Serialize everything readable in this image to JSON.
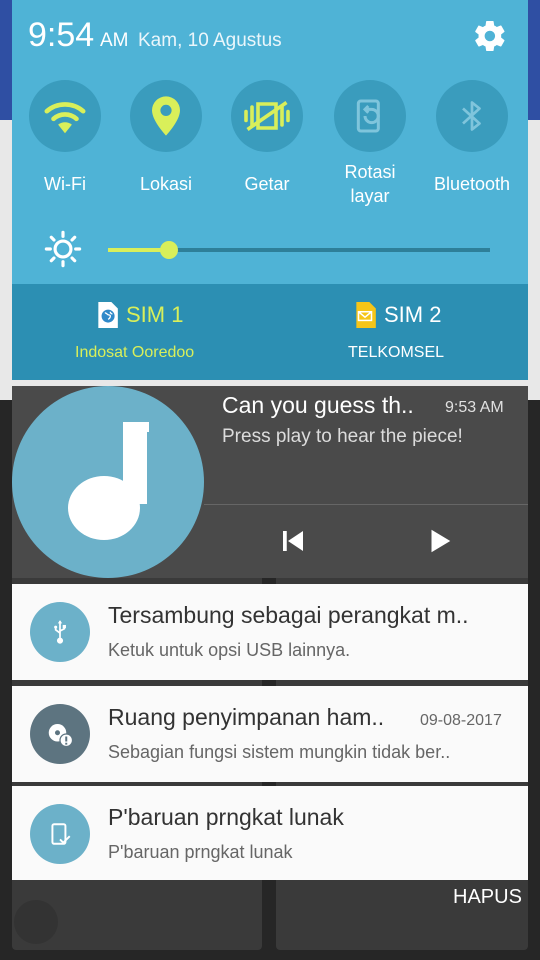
{
  "status": {
    "time": "9:54",
    "ampm": "AM",
    "date": "Kam, 10 Agustus"
  },
  "quick_settings": [
    {
      "label": "Wi-Fi",
      "icon": "wifi-icon",
      "active": true
    },
    {
      "label": "Lokasi",
      "icon": "location-icon",
      "active": true
    },
    {
      "label": "Getar",
      "icon": "vibrate-icon",
      "active": true
    },
    {
      "label": "Rotasi layar",
      "icon": "rotate-icon",
      "active": false
    },
    {
      "label": "Bluetooth",
      "icon": "bluetooth-icon",
      "active": false
    }
  ],
  "brightness": {
    "level": 0.16
  },
  "sims": [
    {
      "name": "SIM 1",
      "operator": "Indosat Ooredoo",
      "color": "#d9ef5a",
      "icon": "globe-icon"
    },
    {
      "name": "SIM 2",
      "operator": "TELKOMSEL",
      "color": "#ffffff",
      "icon": "envelope-icon"
    }
  ],
  "media": {
    "title": "Can you guess th..",
    "time": "9:53 AM",
    "subtitle": "Press play to hear the piece!"
  },
  "notifications": [
    {
      "title": "Tersambung sebagai perangkat m..",
      "subtitle": "Ketuk untuk opsi USB lainnya.",
      "date": "",
      "icon": "usb-icon"
    },
    {
      "title": "Ruang penyimpanan ham..",
      "subtitle": "Sebagian fungsi sistem mungkin tidak ber..",
      "date": "09-08-2017",
      "icon": "storage-warning-icon"
    },
    {
      "title": "P'baruan prngkat lunak",
      "subtitle": "P'baruan prngkat lunak",
      "date": "",
      "icon": "software-update-icon"
    }
  ],
  "clear_all": "HAPUS",
  "colors": {
    "panel": "#4fb3d6",
    "accent": "#d9ef5a",
    "sim_bar": "#2c8fb3"
  }
}
